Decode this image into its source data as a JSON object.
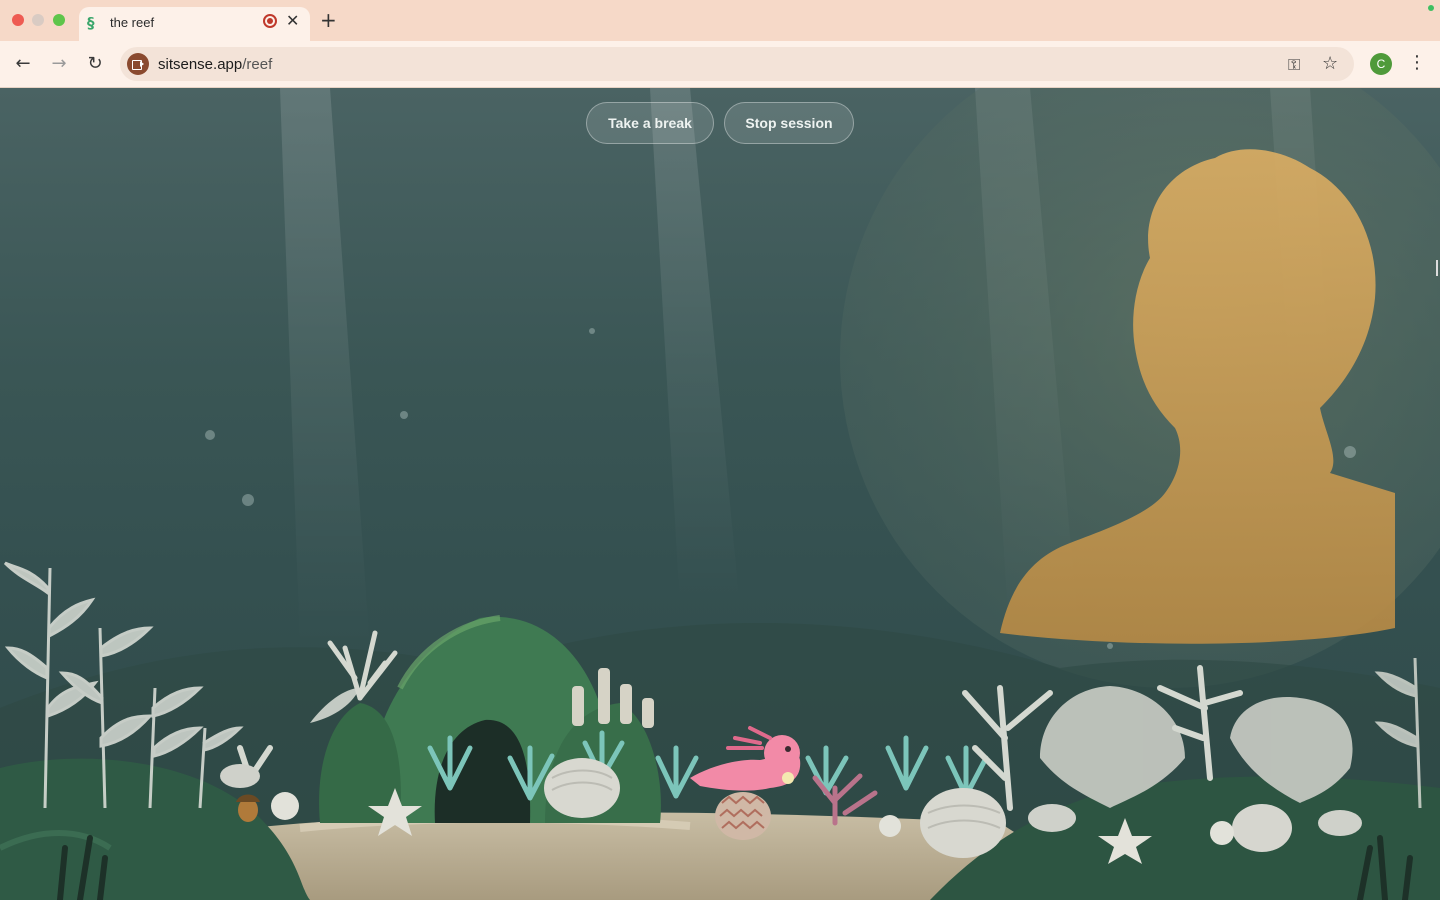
{
  "browser": {
    "tab": {
      "title": "the reef",
      "favicon": "sitsense-logo-icon"
    },
    "address_bar": {
      "domain": "sitsense.app",
      "path": "/reef"
    },
    "profile_initial": "C",
    "icons": [
      "back-icon",
      "forward-icon",
      "reload-icon",
      "password-key-icon",
      "bookmark-star-icon",
      "more-menu-icon"
    ]
  },
  "page": {
    "buttons": {
      "take_break": "Take a break",
      "stop_session": "Stop session"
    }
  },
  "colors": {
    "water": "#3a5655",
    "camera_silhouette": "#d4a85a",
    "axolotl": "#f28aa7",
    "sand": "#c9bea5",
    "accent_green": "#4f9a3a"
  }
}
